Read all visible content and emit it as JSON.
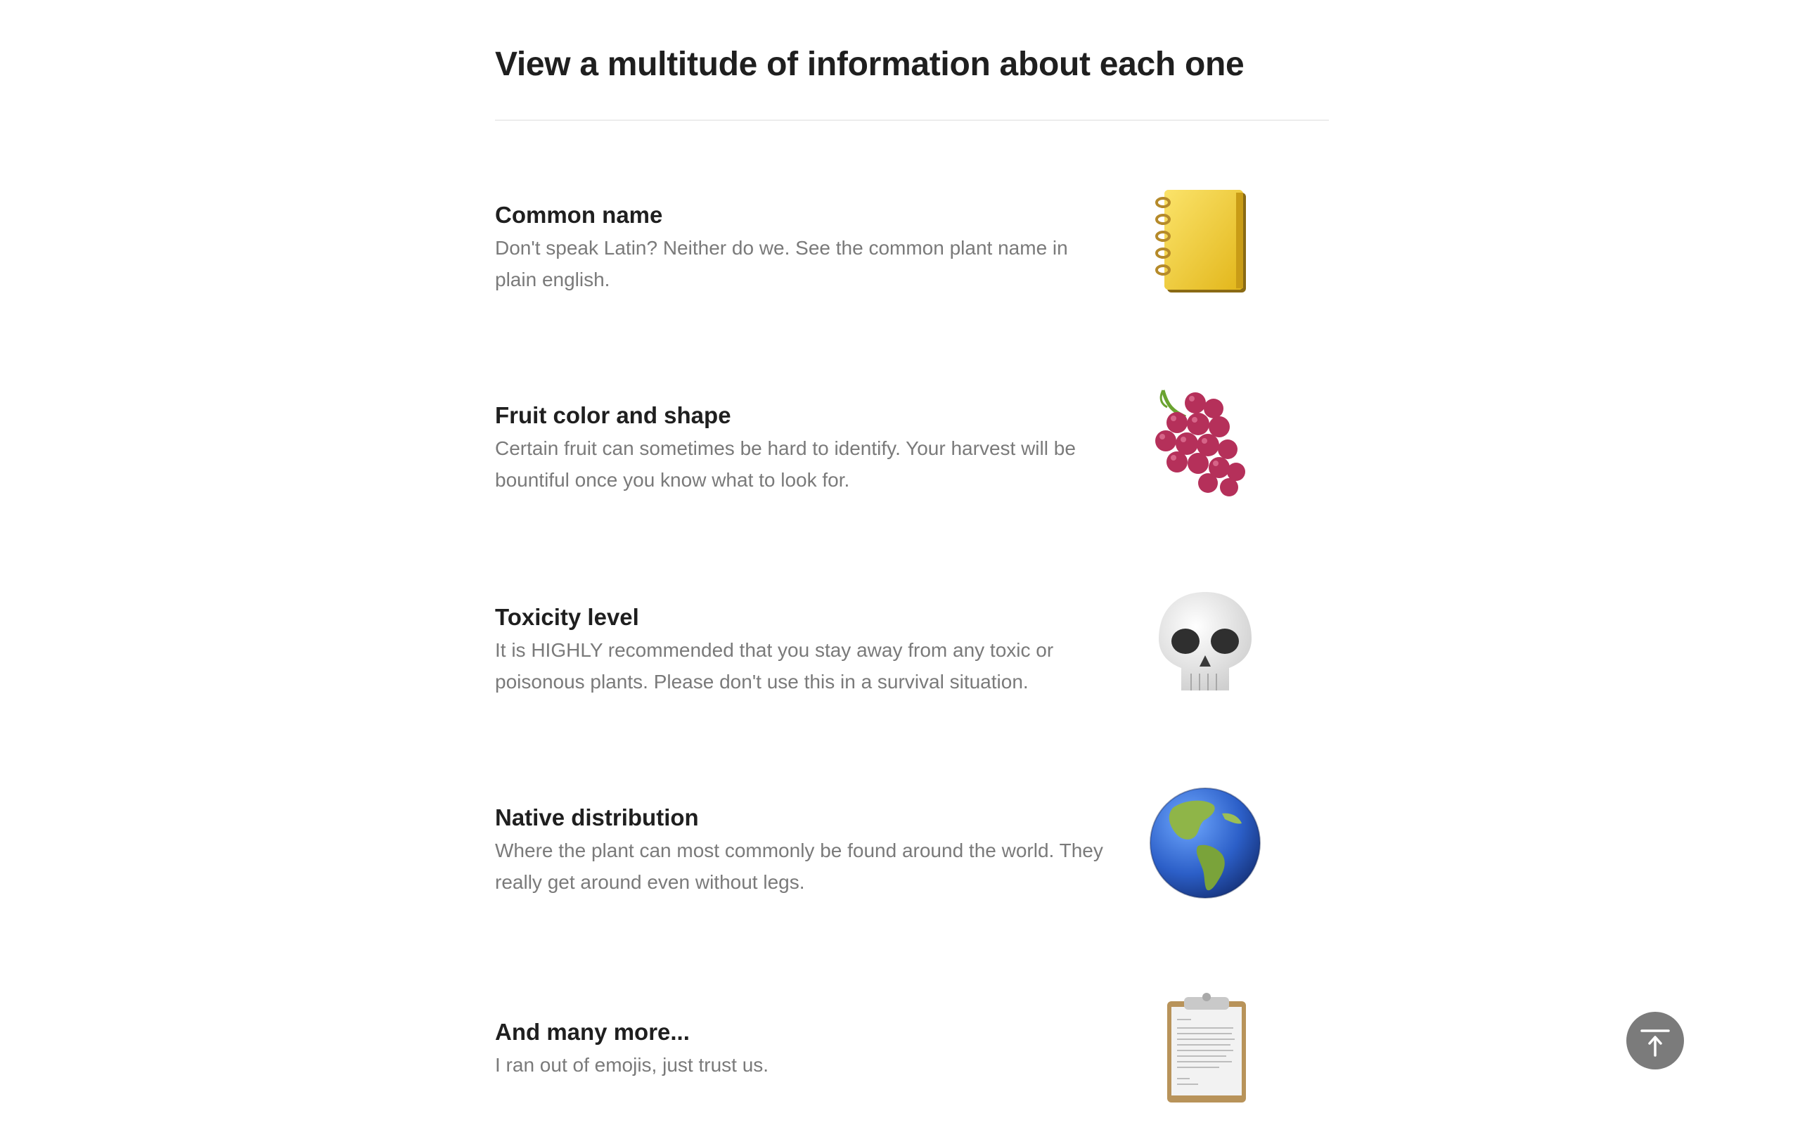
{
  "section": {
    "heading": "View a multitude of information about each one"
  },
  "features": [
    {
      "title": "Common name",
      "description": "Don't speak Latin? Neither do we. See the common plant name in plain english.",
      "icon": "notebook-icon"
    },
    {
      "title": "Fruit color and shape",
      "description": "Certain fruit can sometimes be hard to identify. Your harvest will be bountiful once you know what to look for.",
      "icon": "grapes-icon"
    },
    {
      "title": "Toxicity level",
      "description": "It is HIGHLY recommended that you stay away from any toxic or poisonous plants. Please don't use this in a survival situation.",
      "icon": "skull-icon"
    },
    {
      "title": "Native distribution",
      "description": "Where the plant can most commonly be found around the world. They really get around even without legs.",
      "icon": "globe-americas-icon"
    },
    {
      "title": "And many more...",
      "description": "I ran out of emojis, just trust us.",
      "icon": "clipboard-icon"
    }
  ],
  "back_to_top": {
    "icon": "arrow-up-to-top-icon",
    "color": "#7b7b7b"
  }
}
